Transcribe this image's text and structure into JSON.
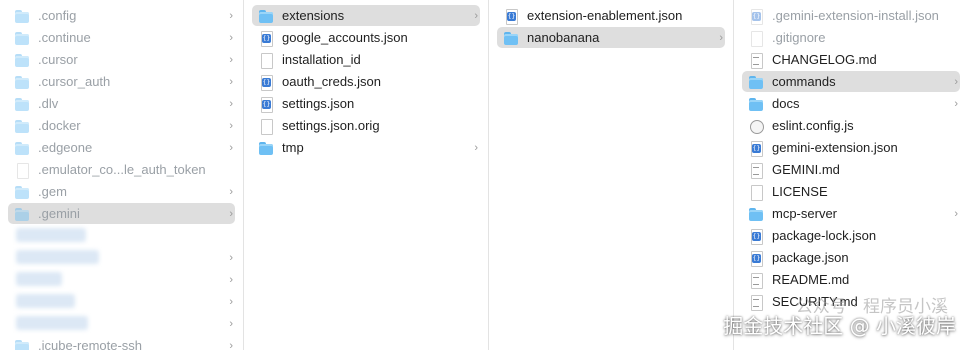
{
  "columns": [
    {
      "id": "col1",
      "items": [
        {
          "label": ".config",
          "icon": "folder-icon",
          "hidden": true,
          "chevron": true
        },
        {
          "label": ".continue",
          "icon": "folder-icon",
          "hidden": true,
          "chevron": true
        },
        {
          "label": ".cursor",
          "icon": "folder-icon",
          "hidden": true,
          "chevron": true
        },
        {
          "label": ".cursor_auth",
          "icon": "folder-icon",
          "hidden": true,
          "chevron": true
        },
        {
          "label": ".dlv",
          "icon": "folder-icon",
          "hidden": true,
          "chevron": true
        },
        {
          "label": ".docker",
          "icon": "folder-icon",
          "hidden": true,
          "chevron": true
        },
        {
          "label": ".edgeone",
          "icon": "folder-icon",
          "hidden": true,
          "chevron": true
        },
        {
          "label": ".emulator_co...le_auth_token",
          "icon": "document-icon",
          "hidden": true,
          "chevron": false
        },
        {
          "label": ".gem",
          "icon": "folder-icon",
          "hidden": true,
          "chevron": true
        },
        {
          "label": ".gemini",
          "icon": "folder-icon",
          "hidden": true,
          "chevron": true,
          "selected": true
        },
        {
          "label": "",
          "icon": "",
          "hidden": true,
          "chevron": false
        },
        {
          "label": "",
          "icon": "",
          "hidden": true,
          "chevron": true
        },
        {
          "label": "",
          "icon": "",
          "hidden": true,
          "chevron": true
        },
        {
          "label": "",
          "icon": "",
          "hidden": true,
          "chevron": true
        },
        {
          "label": "",
          "icon": "",
          "hidden": true,
          "chevron": true
        },
        {
          "label": ".icube-remote-ssh",
          "icon": "folder-icon",
          "hidden": true,
          "chevron": true
        }
      ]
    },
    {
      "id": "col2",
      "items": [
        {
          "label": "extensions",
          "icon": "folder-icon",
          "chevron": true,
          "selected": true
        },
        {
          "label": "google_accounts.json",
          "icon": "json-file-icon",
          "chevron": false
        },
        {
          "label": "installation_id",
          "icon": "document-icon",
          "chevron": false
        },
        {
          "label": "oauth_creds.json",
          "icon": "json-file-icon",
          "chevron": false
        },
        {
          "label": "settings.json",
          "icon": "json-file-icon",
          "chevron": false
        },
        {
          "label": "settings.json.orig",
          "icon": "document-icon",
          "chevron": false
        },
        {
          "label": "tmp",
          "icon": "folder-icon",
          "chevron": true
        }
      ]
    },
    {
      "id": "col3",
      "items": [
        {
          "label": "extension-enablement.json",
          "icon": "json-file-icon",
          "chevron": false
        },
        {
          "label": "nanobanana",
          "icon": "folder-icon",
          "chevron": true,
          "selected": true
        }
      ]
    },
    {
      "id": "col4",
      "items": [
        {
          "label": ".gemini-extension-install.json",
          "icon": "json-file-icon",
          "hidden": true,
          "chevron": false
        },
        {
          "label": ".gitignore",
          "icon": "document-icon",
          "hidden": true,
          "chevron": false
        },
        {
          "label": "CHANGELOG.md",
          "icon": "text-file-icon",
          "chevron": false
        },
        {
          "label": "commands",
          "icon": "folder-icon",
          "chevron": true,
          "selected": true
        },
        {
          "label": "docs",
          "icon": "folder-icon",
          "chevron": true
        },
        {
          "label": "eslint.config.js",
          "icon": "js-file-icon",
          "chevron": false
        },
        {
          "label": "gemini-extension.json",
          "icon": "json-file-icon",
          "chevron": false
        },
        {
          "label": "GEMINI.md",
          "icon": "text-file-icon",
          "chevron": false
        },
        {
          "label": "LICENSE",
          "icon": "document-icon",
          "chevron": false
        },
        {
          "label": "mcp-server",
          "icon": "folder-icon",
          "chevron": true
        },
        {
          "label": "package-lock.json",
          "icon": "json-file-icon",
          "chevron": false
        },
        {
          "label": "package.json",
          "icon": "json-file-icon",
          "chevron": false
        },
        {
          "label": "README.md",
          "icon": "text-file-icon",
          "chevron": false
        },
        {
          "label": "SECURITY.md",
          "icon": "text-file-icon",
          "chevron": false
        }
      ]
    }
  ],
  "watermark": {
    "text": "掘金技术社区 @ 小溪彼岸",
    "background_text": "公众号 · 程序员小溪"
  },
  "chevron_glyph": "›",
  "colors": {
    "selection": "#dedede",
    "folder": "#6fc0f4",
    "hidden_text": "#9aa0a6"
  }
}
